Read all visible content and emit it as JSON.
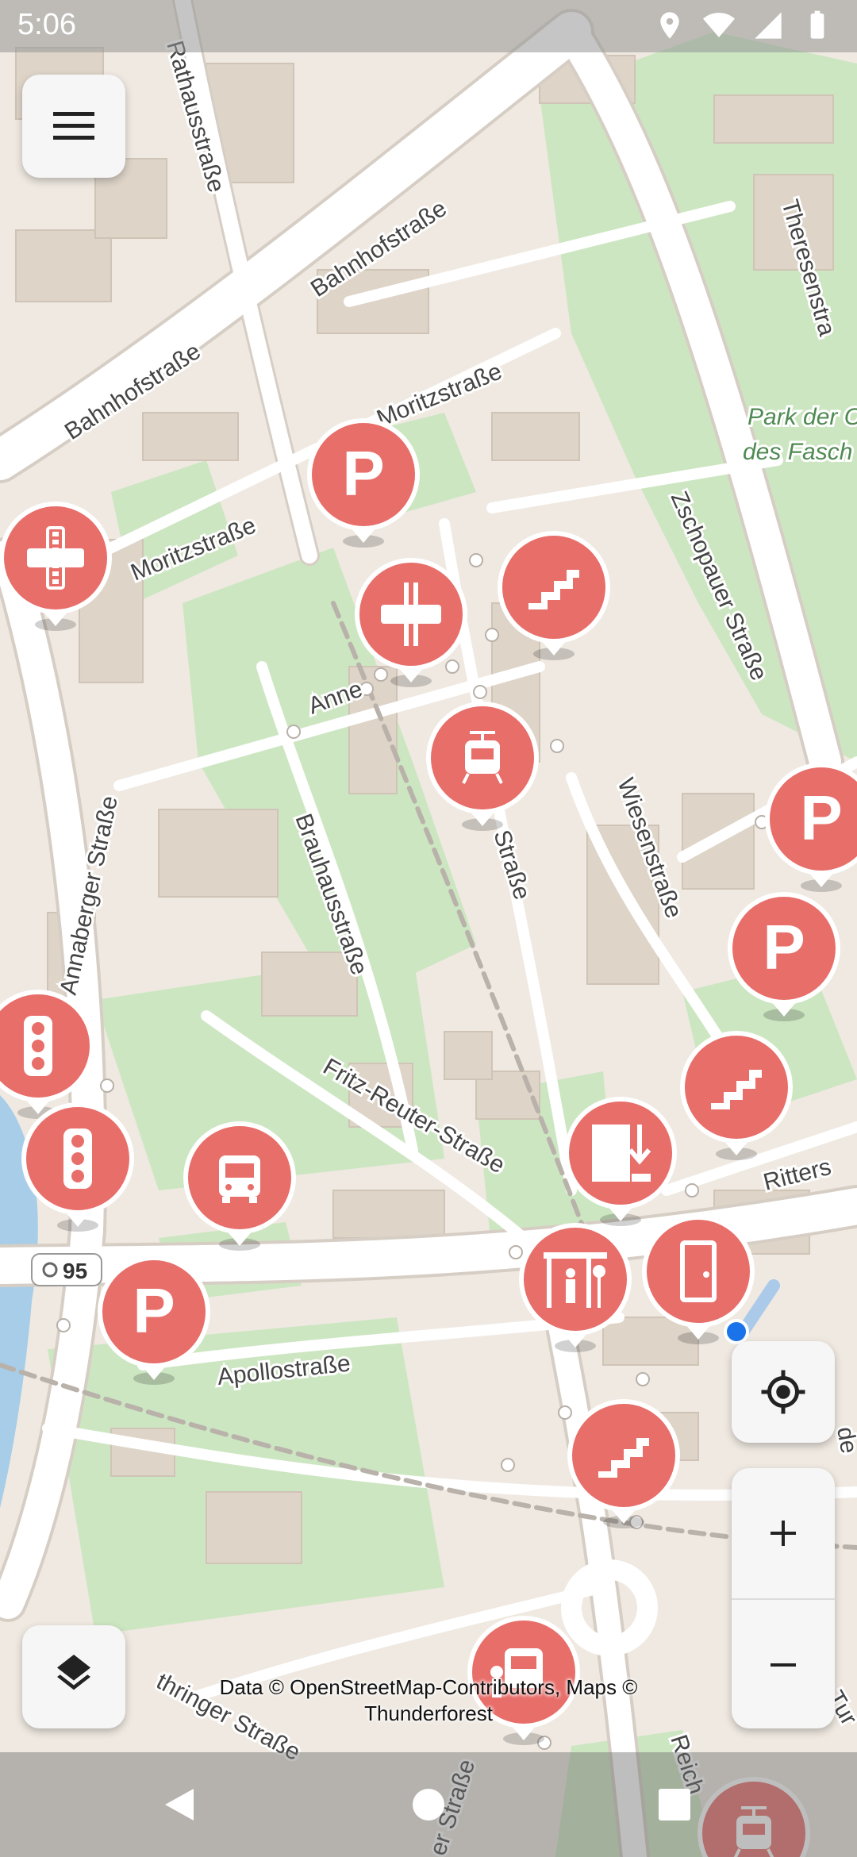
{
  "status_bar": {
    "time": "5:06",
    "icons": [
      "location-icon",
      "wifi-icon",
      "cellular-signal-icon",
      "battery-icon"
    ]
  },
  "map": {
    "street_labels": {
      "rathausstrasse": "Rathausstraße",
      "bahnhofstrasse_1": "Bahnhofstraße",
      "bahnhofstrasse_2": "Bahnhofstraße",
      "moritzstrasse_1": "Moritzstraße",
      "moritzstrasse_2": "Moritzstraße",
      "theresenstrasse": "Theresenstra",
      "zschopauer_strasse": "Zschopauer Straße",
      "annaberger_strasse": "Annaberger Straße",
      "brauhausstrasse": "Brauhausstraße",
      "wiesenstrasse": "Wiesenstraße",
      "annenstrasse": "Anne",
      "strasse_fragment": "Straße",
      "fritz_reuter_strasse": "Fritz-Reuter-Straße",
      "apollostrasse": "Apollostraße",
      "ritters": "Ritters",
      "thringer_strasse": "thringer Straße",
      "er_strasse": "er Straße",
      "reich": "Reich",
      "tur": "Tur",
      "de": "de"
    },
    "park_label_1": "Park der O",
    "park_label_2": "des Fasch",
    "bus_route_number": "95",
    "pins": [
      "parking-icon",
      "railway-crossing-icon",
      "level-crossing-icon",
      "steps-icon",
      "tram-stop-icon",
      "parking-icon",
      "parking-icon",
      "steps-icon",
      "traffic-signals-icon",
      "traffic-signals-icon",
      "bus-stop-icon",
      "entrance-icon",
      "parking-icon",
      "shelter-icon",
      "door-icon",
      "steps-icon",
      "bus-station-icon",
      "tram-stop-icon"
    ],
    "colors": {
      "pin": "#e86e6a",
      "pin_border": "#ffffff",
      "land": "#efe9e1",
      "park": "#cde6c2",
      "building": "#dfd6ca",
      "road": "#ffffff",
      "water": "#a7cde8",
      "location_dot": "#1a73e8"
    }
  },
  "controls": {
    "menu": "hamburger-menu-icon",
    "layers": "layers-icon",
    "locate": "my-location-icon",
    "zoom_in": "+",
    "zoom_out": "−"
  },
  "attribution": {
    "line1": "Data © OpenStreetMap-Contributors, Maps ©",
    "line2": "Thunderforest"
  },
  "navigation_bar": {
    "icons": [
      "back-icon",
      "home-icon",
      "recents-icon"
    ]
  }
}
